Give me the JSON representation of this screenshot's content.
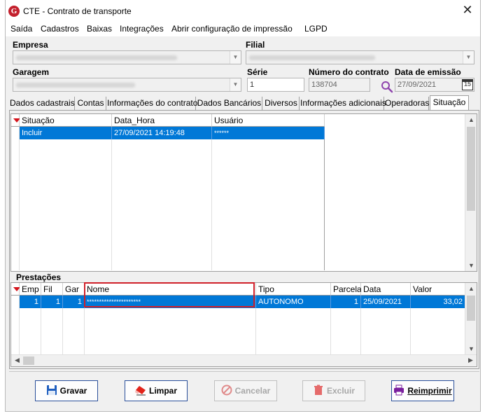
{
  "window": {
    "title": "CTE - Contrato de transporte",
    "close_symbol": "✕"
  },
  "menu": {
    "items": [
      {
        "label": "Saída"
      },
      {
        "label": "Cadastros"
      },
      {
        "label": "Baixas"
      },
      {
        "label": "Integrações"
      },
      {
        "label": "Abrir configuração de impressão"
      },
      {
        "label": "LGPD"
      }
    ]
  },
  "form": {
    "empresa_label": "Empresa",
    "filial_label": "Filial",
    "garagem_label": "Garagem",
    "serie_label": "Série",
    "serie_value": "1",
    "numero_label": "Número do contrato",
    "numero_value": "138704",
    "data_label": "Data de emissão",
    "data_value": "27/09/2021",
    "calendar_day": "15"
  },
  "tabs": [
    {
      "label": "Dados cadastrais"
    },
    {
      "label": "Contas"
    },
    {
      "label": "Informações do contrato"
    },
    {
      "label": "Dados Bancários"
    },
    {
      "label": "Diversos"
    },
    {
      "label": "Informações adicionais"
    },
    {
      "label": "Operadoras"
    },
    {
      "label": "Situação"
    }
  ],
  "situacao_grid": {
    "columns": [
      "Situação",
      "Data_Hora",
      "Usuário"
    ],
    "rows": [
      {
        "situacao": "Incluir",
        "data_hora": "27/09/2021 14:19:48",
        "usuario": "******"
      }
    ]
  },
  "prestacoes": {
    "title": "Prestações",
    "columns": [
      "Emp",
      "Fil",
      "Gar",
      "Nome",
      "Tipo",
      "Parcela",
      "Data",
      "Valor"
    ],
    "rows": [
      {
        "emp": "1",
        "fil": "1",
        "gar": "1",
        "nome": "**********************",
        "tipo": "AUTONOMO",
        "parcela": "1",
        "data": "25/09/2021",
        "valor": "33,02"
      }
    ]
  },
  "buttons": {
    "gravar": "Gravar",
    "limpar": "Limpar",
    "cancelar": "Cancelar",
    "excluir": "Excluir",
    "reimprimir": "Reimprimir"
  },
  "colors": {
    "selection": "#0078d7",
    "highlight_border": "#d0202a",
    "button_border": "#2a4f9a"
  }
}
